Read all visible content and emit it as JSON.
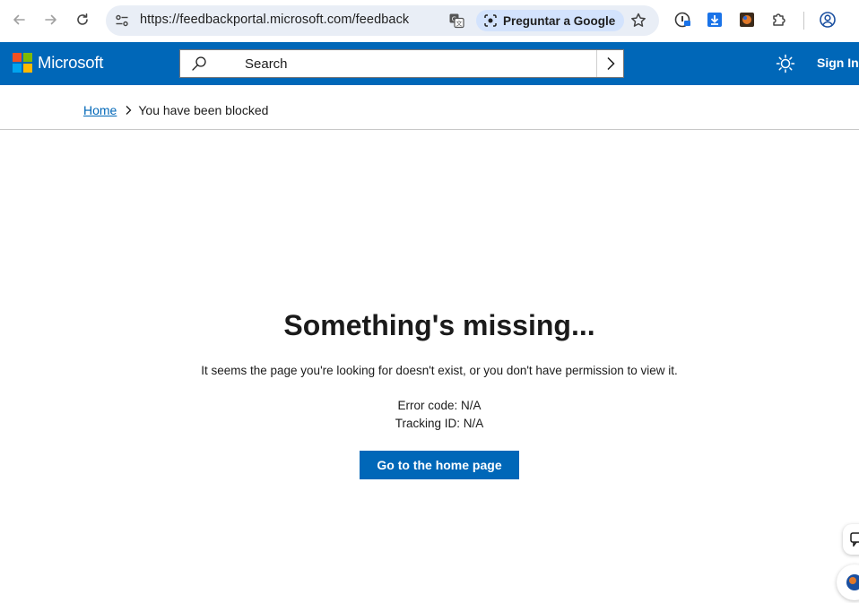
{
  "browser": {
    "url": "https://feedbackportal.microsoft.com/feedback",
    "ask_google_label": "Preguntar a Google"
  },
  "header": {
    "brand": "Microsoft",
    "search_placeholder": "Search",
    "sign_in": "Sign In",
    "colors": {
      "bar": "#0067b8",
      "logo_red": "#f25022",
      "logo_green": "#7fba00",
      "logo_blue": "#00a4ef",
      "logo_yellow": "#ffb900"
    }
  },
  "breadcrumb": {
    "home": "Home",
    "current": "You have been blocked"
  },
  "main": {
    "title": "Something's missing...",
    "description": "It seems the page you're looking for doesn't exist, or you don't have permission to view it.",
    "error_code": "Error code: N/A",
    "tracking_id": "Tracking ID: N/A",
    "home_button": "Go to the home page"
  }
}
